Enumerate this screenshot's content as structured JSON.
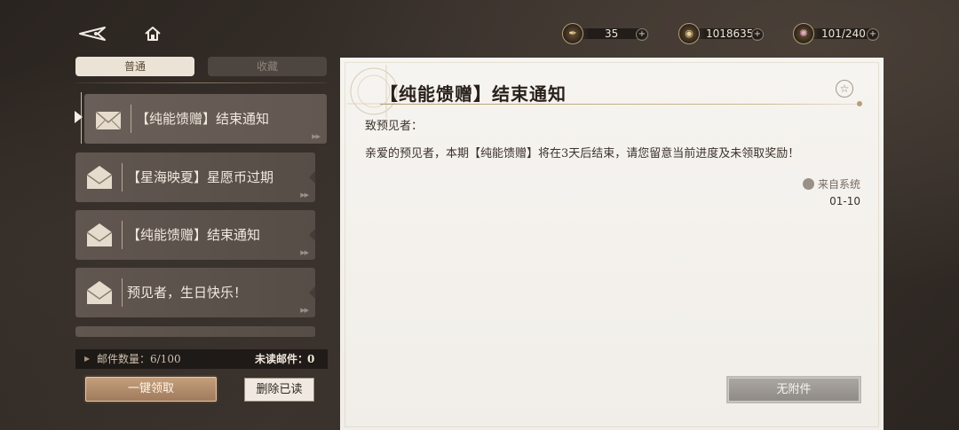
{
  "topbar": {
    "back_icon": "back-arrow-icon",
    "home_icon": "home-icon",
    "resources": [
      {
        "icon": "quill-stamina-icon",
        "value": "35"
      },
      {
        "icon": "gold-coin-icon",
        "value": "1018635"
      },
      {
        "icon": "crystal-orb-icon",
        "value": "101/240"
      }
    ],
    "plus_label": "+"
  },
  "tabs": [
    {
      "label": "普通",
      "active": true
    },
    {
      "label": "收藏",
      "active": false
    }
  ],
  "mail_list": [
    {
      "title": "【纯能馈赠】结束通知",
      "selected": true
    },
    {
      "title": "【星海映夏】星愿币过期",
      "selected": false
    },
    {
      "title": "【纯能馈赠】结束通知",
      "selected": false
    },
    {
      "title": "预见者，生日快乐！",
      "selected": false
    }
  ],
  "mail_arrows": "▶▶",
  "footer": {
    "count_label": "邮件数量：6/100",
    "unread_label": "未读邮件：",
    "unread_count": "0",
    "claim_all": "一键领取",
    "delete_read": "删除已读"
  },
  "detail": {
    "title": "【纯能馈赠】结束通知",
    "greeting": "致预见者：",
    "body": "亲爱的预见者，本期【纯能馈赠】将在3天后结束，请您留意当前进度及未领取奖励！",
    "sender": "来自系统",
    "date": "01-10",
    "no_attachment": "无附件"
  },
  "colors": {
    "panel_bg": "#f4f2ee",
    "accent_gold": "#b69e77",
    "claim_button": "#b38d6b",
    "tab_active": "#ebe3d6"
  }
}
